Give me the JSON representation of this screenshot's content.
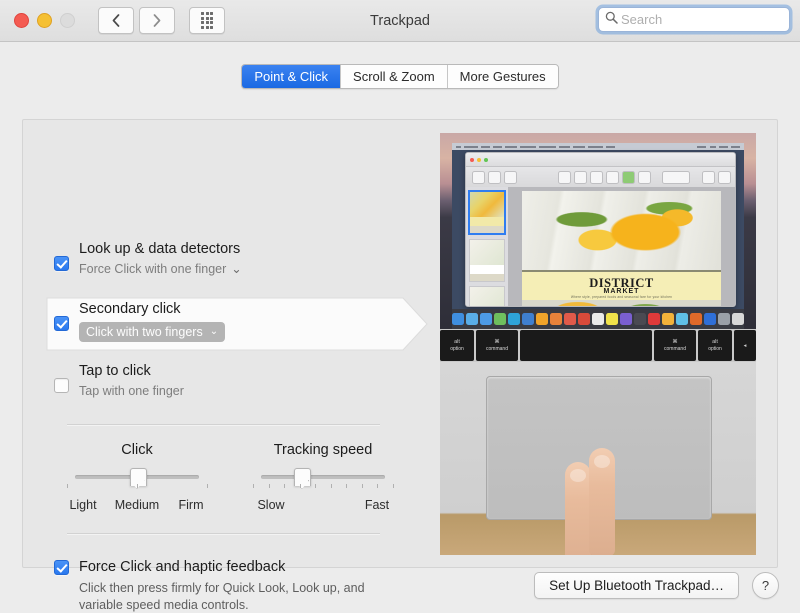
{
  "window": {
    "title": "Trackpad",
    "traffic_lights": [
      "close",
      "minimize",
      "zoom"
    ],
    "nav_back": "‹",
    "nav_forward": "›",
    "grid_button": "show-all-preferences"
  },
  "search": {
    "placeholder": "Search",
    "value": "",
    "icon": "search-icon"
  },
  "tabs": [
    {
      "label": "Point & Click",
      "active": true
    },
    {
      "label": "Scroll & Zoom",
      "active": false
    },
    {
      "label": "More Gestures",
      "active": false
    }
  ],
  "options": [
    {
      "id": "look-up",
      "title": "Look up & data detectors",
      "subtitle": "Force Click with one finger",
      "checked": true,
      "has_popup": true,
      "selected": false
    },
    {
      "id": "secondary-click",
      "title": "Secondary click",
      "subtitle": "Click with two fingers",
      "checked": true,
      "has_popup": true,
      "selected": true
    },
    {
      "id": "tap-to-click",
      "title": "Tap to click",
      "subtitle": "Tap with one finger",
      "checked": false,
      "has_popup": false,
      "selected": false
    }
  ],
  "caret_glyph": "⌄",
  "sliders": [
    {
      "id": "click",
      "title": "Click",
      "ticks": 3,
      "value_percent": 50,
      "labels": [
        {
          "text": "Light",
          "percent": 0
        },
        {
          "text": "Medium",
          "percent": 50
        },
        {
          "text": "Firm",
          "percent": 100
        }
      ]
    },
    {
      "id": "tracking-speed",
      "title": "Tracking speed",
      "ticks": 10,
      "value_percent": 33,
      "labels": [
        {
          "text": "Slow",
          "percent": 0
        },
        {
          "text": "Fast",
          "percent": 100
        }
      ]
    }
  ],
  "force_click": {
    "title": "Force Click and haptic feedback",
    "checked": true,
    "description": "Click then press firmly for Quick Look, Look up, and variable speed media controls."
  },
  "footer": {
    "setup_button": "Set Up Bluetooth Trackpad…",
    "help_button": "?"
  },
  "preview": {
    "description": "demonstration-video-two-finger-click-on-trackpad",
    "document": {
      "title": "DISTRICT",
      "subtitle": "MARKET",
      "tagline": "Where style, prepared foods and seasonal fare for your kitchen"
    },
    "keys": [
      {
        "sym": "alt",
        "label": "option"
      },
      {
        "sym": "⌘",
        "label": "command"
      },
      {
        "sym": "",
        "label": "",
        "spacebar": true
      },
      {
        "sym": "⌘",
        "label": "command"
      },
      {
        "sym": "alt",
        "label": "option"
      },
      {
        "sym": "◂",
        "label": ""
      }
    ]
  },
  "colors": {
    "accent": "#2a78ee",
    "tab_active_bg": "#1a69e3",
    "window_bg": "#ececec",
    "panel_bg": "#e7e7e7",
    "popup_bg": "#b4b4b4"
  }
}
